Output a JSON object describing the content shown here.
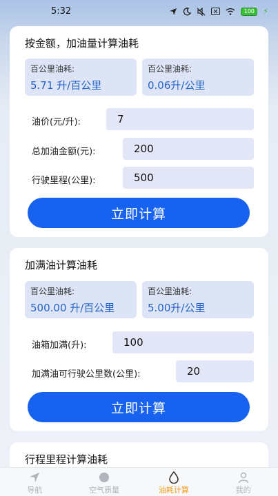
{
  "status_bar": {
    "time": "5:32",
    "battery": "100"
  },
  "card1": {
    "title": "按金额，加油量计算油耗",
    "stat_left": {
      "label": "百公里油耗:",
      "value": "5.71 升/百公里"
    },
    "stat_right": {
      "label": "百公里油耗:",
      "value": "0.06升/公里"
    },
    "fields": [
      {
        "label": "油价(元/升):",
        "value": "7"
      },
      {
        "label": "总加油金额(元):",
        "value": "200"
      },
      {
        "label": "行驶里程(公里):",
        "value": "500"
      }
    ],
    "button": "立即计算"
  },
  "card2": {
    "title": "加满油计算油耗",
    "stat_left": {
      "label": "百公里油耗:",
      "value": "500.00 升/百公里"
    },
    "stat_right": {
      "label": "百公里油耗:",
      "value": "5.00升/公里"
    },
    "fields": [
      {
        "label": "油箱加满(升):",
        "value": "100"
      },
      {
        "label": "加满油可行驶公里数(公里):",
        "value": "20"
      }
    ],
    "button": "立即计算"
  },
  "card3": {
    "title": "行程里程计算油耗"
  },
  "tabs": [
    {
      "label": "导航",
      "icon": "navigation-arrow-icon"
    },
    {
      "label": "空气质量",
      "icon": "air-quality-icon"
    },
    {
      "label": "油耗计算",
      "icon": "fuel-drop-icon"
    },
    {
      "label": "我的",
      "icon": "user-icon"
    }
  ],
  "colors": {
    "accent": "#1763f0",
    "value_blue": "#2563c7",
    "active_tab": "#f29a1a",
    "box_bg": "#dde4f6"
  }
}
